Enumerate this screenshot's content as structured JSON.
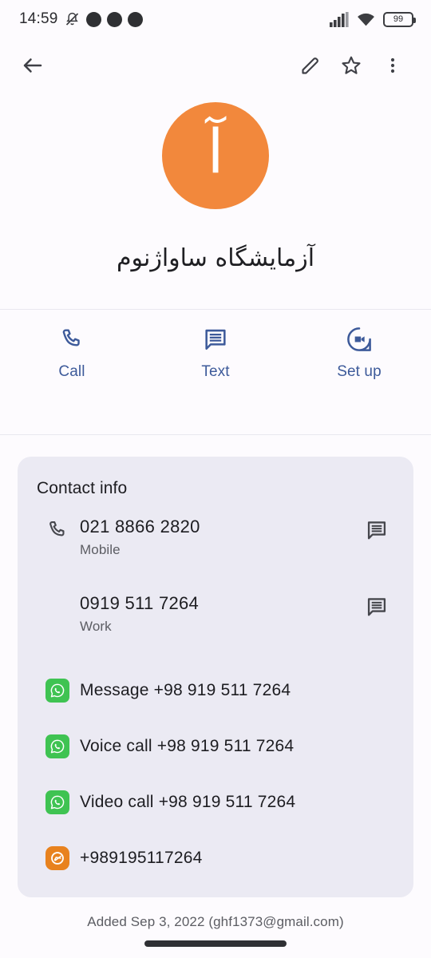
{
  "status_bar": {
    "clock": "14:59",
    "battery_level": "99",
    "icons": [
      "bell-muted-icon",
      "app-icon-dark",
      "chrome-icon",
      "app-icon-globe",
      "signal-bars-icon",
      "wifi-icon",
      "battery-icon"
    ]
  },
  "toolbar": {
    "back_label": "Back",
    "edit_label": "Edit contact",
    "star_label": "Add to favorites",
    "more_label": "More options"
  },
  "contact": {
    "avatar_initial": "آ",
    "avatar_color": "#f2883c",
    "name": "آزمایشگاه ساواژنوم"
  },
  "quick_actions": [
    {
      "label": "Call",
      "icon": "phone-icon"
    },
    {
      "label": "Text",
      "icon": "message-icon"
    },
    {
      "label": "Set up",
      "icon": "video-call-icon"
    }
  ],
  "contact_info": {
    "title": "Contact info",
    "phones": [
      {
        "number": "021 8866 2820",
        "type": "Mobile",
        "trail_icon": "message-icon"
      },
      {
        "number": "0919 511 7264",
        "type": "Work",
        "trail_icon": "message-icon"
      }
    ],
    "app_actions": [
      {
        "label": "Message +98 919 511 7264",
        "app": "whatsapp-icon",
        "color": "#3fc352"
      },
      {
        "label": "Voice call +98 919 511 7264",
        "app": "whatsapp-icon",
        "color": "#3fc352"
      },
      {
        "label": "Video call +98 919 511 7264",
        "app": "whatsapp-icon",
        "color": "#3fc352"
      },
      {
        "label": "+989195117264",
        "app": "eitaa-icon",
        "color": "#e8821e"
      }
    ]
  },
  "footer": {
    "added_text": "Added Sep 3, 2022 (ghf1373@gmail.com)"
  },
  "theme": {
    "background": "#fdfbfe",
    "card_background": "#ebeaf3",
    "accent_blue": "#3d5a9a",
    "text_primary": "#1d1d21",
    "text_secondary": "#5c5d63"
  }
}
